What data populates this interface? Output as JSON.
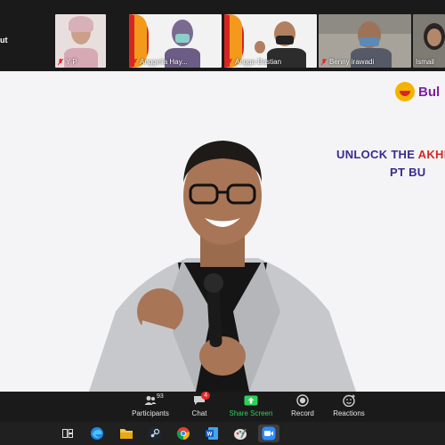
{
  "gallery": {
    "left_label": "ut",
    "participants": [
      {
        "name": "Y P"
      },
      {
        "name": "Anggelia Hay..."
      },
      {
        "name": "Angga Bastian"
      },
      {
        "name": "Benny irawadi"
      },
      {
        "name": "Ismail"
      }
    ]
  },
  "stage": {
    "logo_text": "Bul",
    "headline_part1": "UNLOCK THE ",
    "headline_accent": "AKHL",
    "headline_line2": "PT BU"
  },
  "toolbar": {
    "participants_label": "Participants",
    "participants_count": "93",
    "chat_label": "Chat",
    "chat_badge": "4",
    "share_label": "Share Screen",
    "record_label": "Record",
    "reactions_label": "Reactions"
  },
  "colors": {
    "share_green": "#2ed158",
    "badge_red": "#e02828",
    "brand_purple": "#3a2a8c",
    "brand_red": "#d7261f",
    "brand_orange": "#f39a1c"
  }
}
